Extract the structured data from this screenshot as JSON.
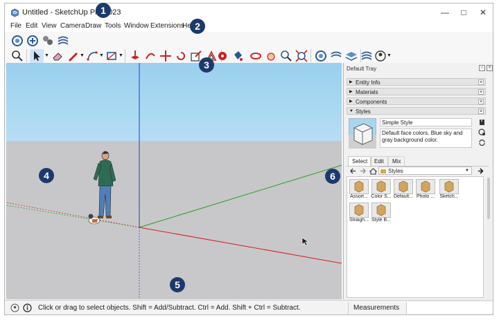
{
  "window": {
    "title": "Untitled - SketchUp Pro 2023",
    "minimize": "—",
    "maximize": "□",
    "close": "✕"
  },
  "menu": [
    "File",
    "Edit",
    "View",
    "Camera",
    "Draw",
    "Tools",
    "Window",
    "Extensions",
    "Help"
  ],
  "callouts": [
    "1",
    "2",
    "3",
    "4",
    "5",
    "6"
  ],
  "viewport": {
    "sky_color": "#a8d8f2",
    "ground_color": "#c8c8ca",
    "red_axis": "#d02020",
    "green_axis": "#20a020",
    "blue_axis": "#2040c0"
  },
  "tray": {
    "title": "Default Tray",
    "panels": [
      {
        "label": "Entity Info",
        "arrow": "▶"
      },
      {
        "label": "Materials",
        "arrow": "▶"
      },
      {
        "label": "Components",
        "arrow": "▶"
      },
      {
        "label": "Styles",
        "arrow": "▼"
      }
    ],
    "close_label": "×",
    "style_name": "Simple Style",
    "style_description": "Default face colors. Blue sky and gray background color.",
    "tabs": [
      "Select",
      "Edit",
      "Mix"
    ],
    "library": "Styles",
    "thumbnails": [
      "Assort...",
      "Color S...",
      "Default...",
      "Photo ...",
      "Sketch...",
      "Straigh...",
      "Style B..."
    ]
  },
  "status": {
    "text": "Click or drag to select objects. Shift = Add/Subtract. Ctrl = Add. Shift + Ctrl = Subtract.",
    "measurements": "Measurements"
  },
  "accent": "#1b3a6b"
}
